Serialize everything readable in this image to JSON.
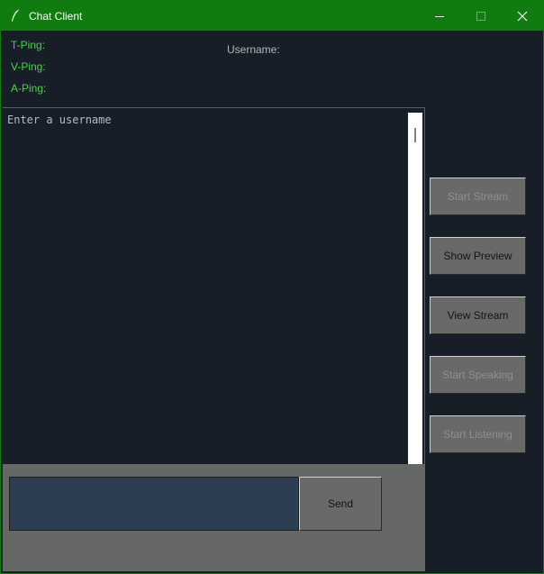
{
  "window": {
    "title": "Chat Client",
    "app_icon": "feather-icon",
    "controls": [
      "minimize-icon",
      "maximize-icon",
      "close-icon"
    ]
  },
  "status": {
    "t_ping_label": "T-Ping:",
    "v_ping_label": "V-Ping:",
    "a_ping_label": "A-Ping:",
    "username_label": "Username:"
  },
  "chat": {
    "text": "Enter a username"
  },
  "input": {
    "value": "",
    "placeholder": ""
  },
  "buttons": {
    "send": "Send",
    "side": [
      {
        "label": "Start Stream",
        "enabled": false
      },
      {
        "label": "Show Preview",
        "enabled": true
      },
      {
        "label": "View Stream",
        "enabled": true
      },
      {
        "label": "Start Speaking",
        "enabled": false
      },
      {
        "label": "Start Listening",
        "enabled": false
      }
    ]
  },
  "colors": {
    "title_bar": "#107c10",
    "background": "#181e28",
    "ping_text": "#44d544",
    "panel": "#666866",
    "input_bg": "#2d3e52"
  }
}
